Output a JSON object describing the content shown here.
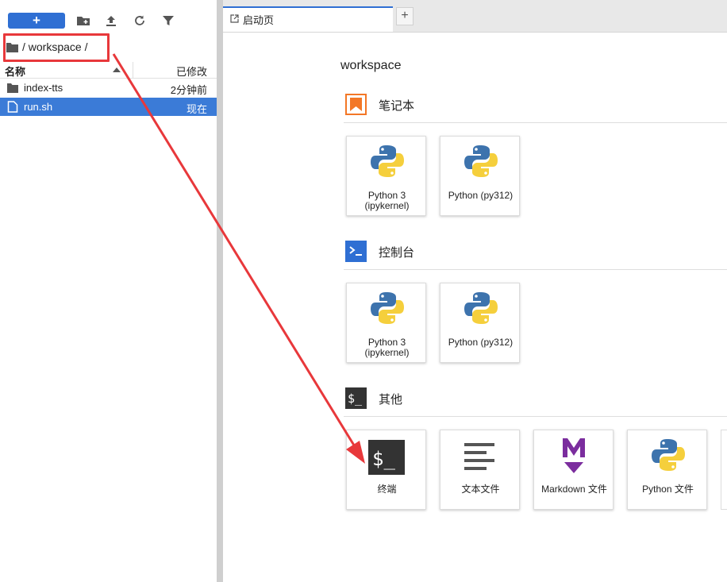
{
  "toolbar": {
    "new_label": "+",
    "icons": [
      "new-folder-icon",
      "upload-icon",
      "refresh-icon",
      "filter-icon"
    ]
  },
  "breadcrumb": {
    "path": "/ workspace /"
  },
  "file_list": {
    "col_name": "名称",
    "col_modified": "已修改",
    "rows": [
      {
        "name": "index-tts",
        "modified": "2分钟前",
        "type": "folder",
        "selected": false
      },
      {
        "name": "run.sh",
        "modified": "现在",
        "type": "file",
        "selected": true
      }
    ]
  },
  "tabs": [
    {
      "label": "启动页"
    }
  ],
  "launcher": {
    "title": "workspace",
    "sections": [
      {
        "title": "笔记本",
        "icon": "notebook-icon",
        "cards": [
          {
            "label": "Python 3\n(ipykernel)",
            "icon": "python-icon"
          },
          {
            "label": "Python (py312)",
            "icon": "python-icon"
          }
        ]
      },
      {
        "title": "控制台",
        "icon": "console-icon",
        "cards": [
          {
            "label": "Python 3\n(ipykernel)",
            "icon": "python-icon"
          },
          {
            "label": "Python (py312)",
            "icon": "python-icon"
          }
        ]
      },
      {
        "title": "其他",
        "icon": "other-icon",
        "cards": [
          {
            "label": "终端",
            "icon": "terminal-icon"
          },
          {
            "label": "文本文件",
            "icon": "text-file-icon"
          },
          {
            "label": "Markdown 文件",
            "icon": "markdown-icon"
          },
          {
            "label": "Python 文件",
            "icon": "python-icon"
          }
        ]
      }
    ]
  },
  "colors": {
    "accent": "#2f6fd3",
    "selected_row": "#3b7bd7",
    "annotation": "#e8383b",
    "notebook": "#f37726"
  }
}
